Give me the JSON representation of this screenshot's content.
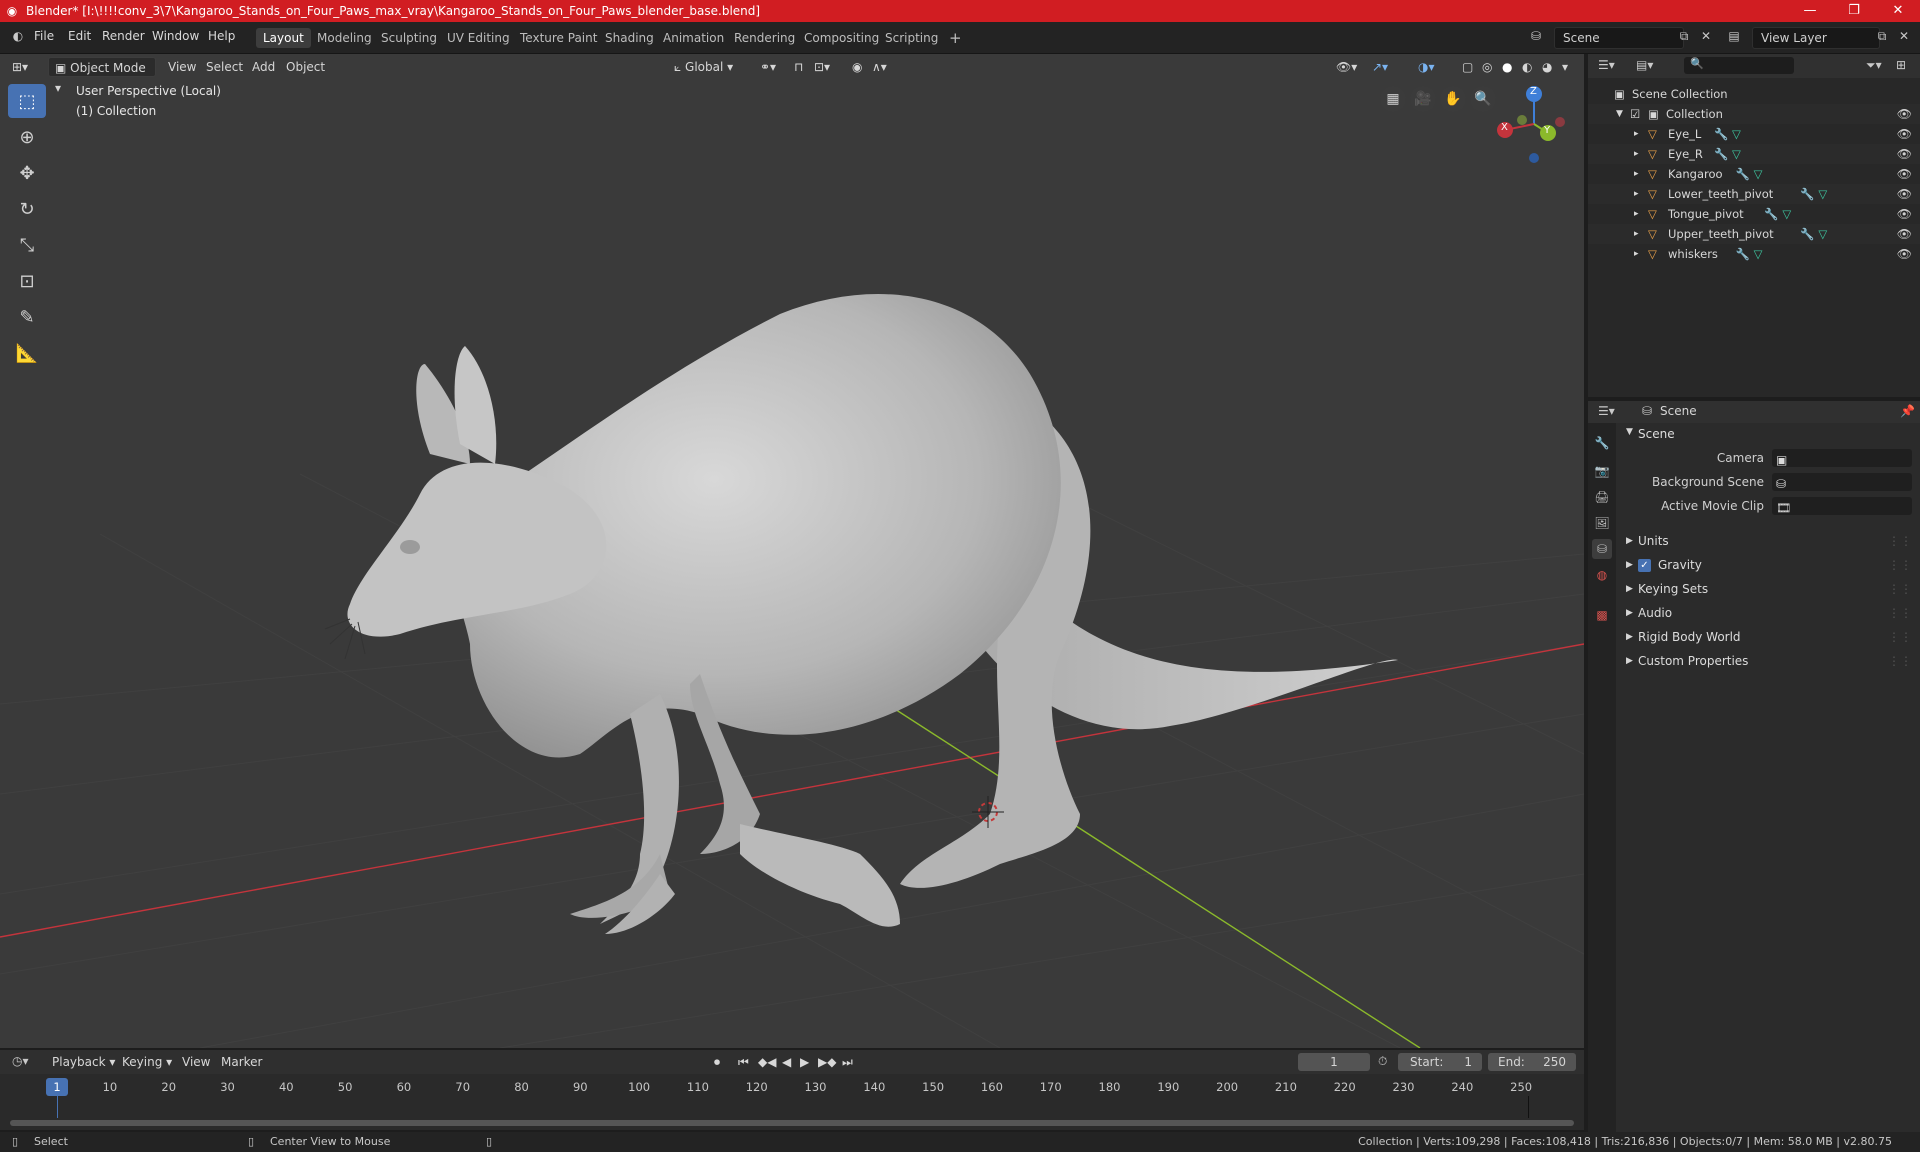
{
  "titlebar": {
    "title": "Blender* [I:\\!!!!conv_3\\7\\Kangaroo_Stands_on_Four_Paws_max_vray\\Kangaroo_Stands_on_Four_Paws_blender_base.blend]",
    "minimize": "—",
    "maximize": "❐",
    "close": "✕"
  },
  "menu": [
    "File",
    "Edit",
    "Render",
    "Window",
    "Help"
  ],
  "workspaces": [
    "Layout",
    "Modeling",
    "Sculpting",
    "UV Editing",
    "Texture Paint",
    "Shading",
    "Animation",
    "Rendering",
    "Compositing",
    "Scripting"
  ],
  "active_workspace": "Layout",
  "scene_field": "Scene",
  "view_layer_field": "View Layer",
  "viewport_header": {
    "mode": "Object Mode",
    "items": [
      "View",
      "Select",
      "Add",
      "Object"
    ],
    "orientation": "Global"
  },
  "viewport": {
    "perspective": "User Perspective (Local)",
    "collection": "(1) Collection"
  },
  "gizmo": {
    "x": "X",
    "y": "Y",
    "z": "Z"
  },
  "outliner": {
    "root": "Scene Collection",
    "collection": "Collection",
    "objects": [
      "Eye_L",
      "Eye_R",
      "Kangaroo",
      "Lower_teeth_pivot",
      "Tongue_pivot",
      "Upper_teeth_pivot",
      "whiskers"
    ]
  },
  "properties": {
    "header": "Scene",
    "panel": "Scene",
    "camera_label": "Camera",
    "background_label": "Background Scene",
    "movieclip_label": "Active Movie Clip",
    "sections": [
      "Units",
      "Gravity",
      "Keying Sets",
      "Audio",
      "Rigid Body World",
      "Custom Properties"
    ],
    "gravity_checked": true
  },
  "timeline": {
    "menus": [
      "Playback",
      "Keying",
      "View",
      "Marker"
    ],
    "current_frame": "1",
    "start_label": "Start:",
    "start": "1",
    "end_label": "End:",
    "end": "250",
    "ticks": [
      "1",
      "10",
      "20",
      "30",
      "40",
      "50",
      "60",
      "70",
      "80",
      "90",
      "100",
      "110",
      "120",
      "130",
      "140",
      "150",
      "160",
      "170",
      "180",
      "190",
      "200",
      "210",
      "220",
      "230",
      "240",
      "250"
    ]
  },
  "statusbar": {
    "left1": "Select",
    "left2": "Center View to Mouse",
    "right": "Collection | Verts:109,298 | Faces:108,418 | Tris:216,836 | Objects:0/7 | Mem: 58.0 MB | v2.80.75"
  },
  "colors": {
    "titlebar": "#d11d22",
    "accent": "#4772b3",
    "viewport_bg": "#3a3a3a",
    "x_axis": "#c4343c",
    "y_axis": "#8bb92b",
    "z_axis": "#3f7fd8"
  }
}
